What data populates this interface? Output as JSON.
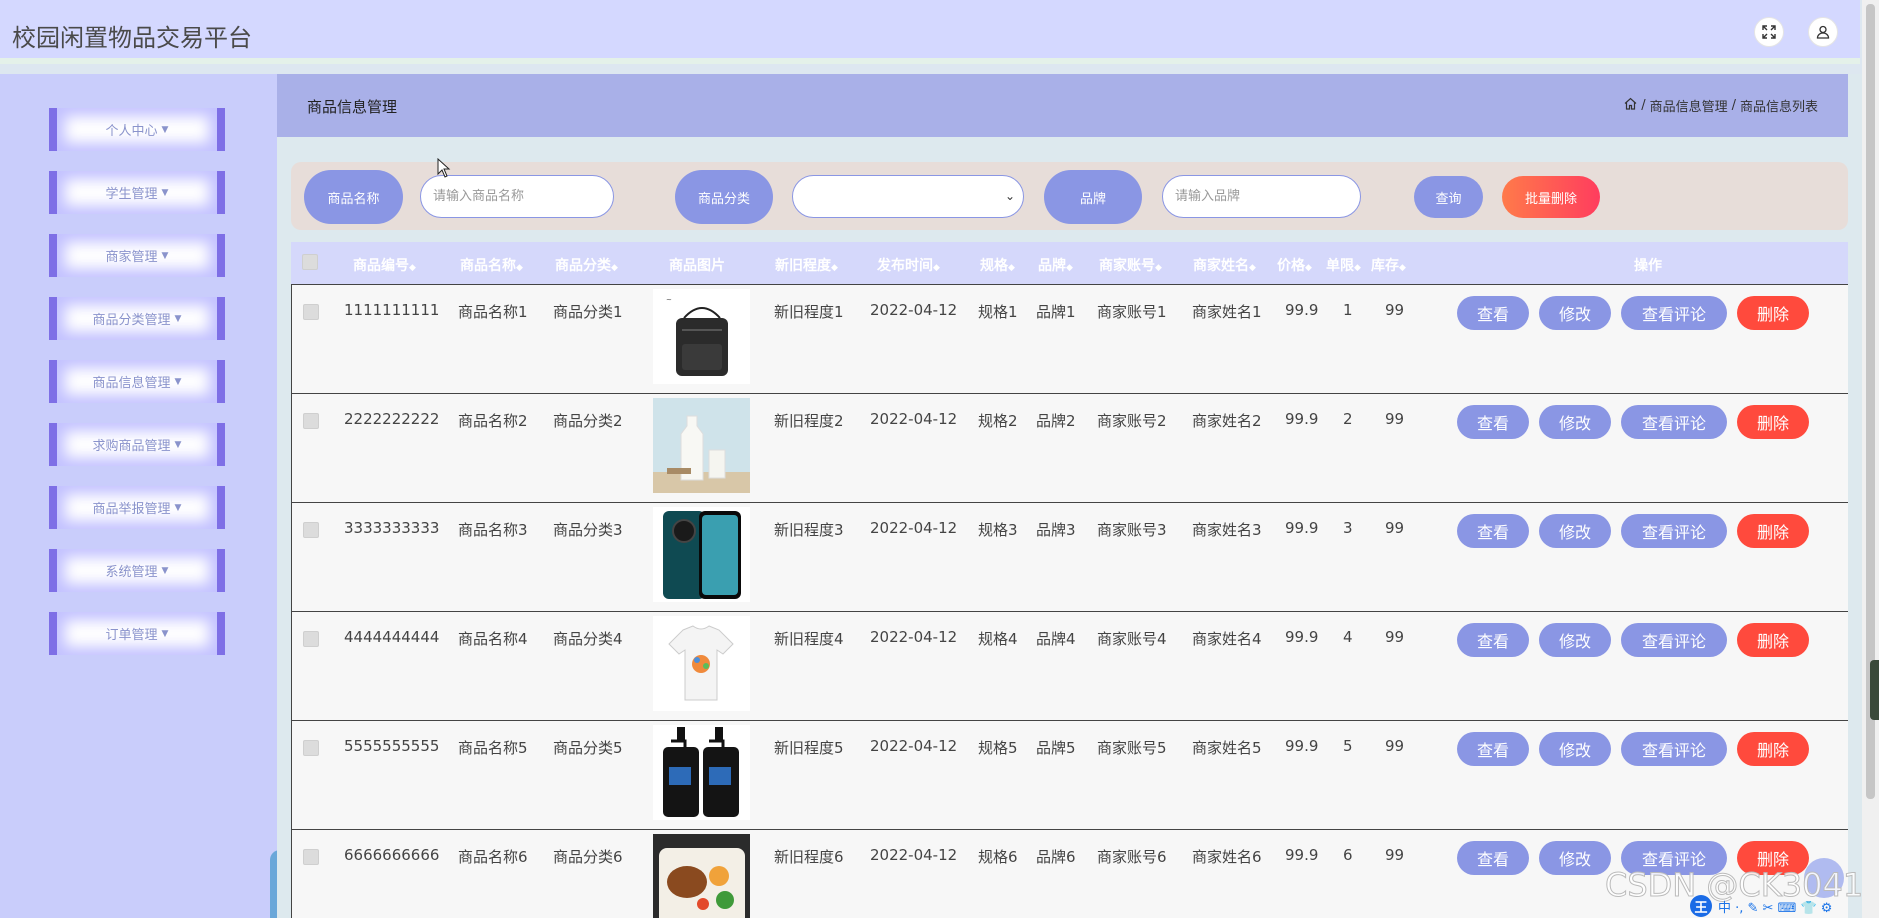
{
  "header": {
    "title": "校园闲置物品交易平台",
    "fullscreen_icon": "fullscreen-icon",
    "user_icon": "user-icon"
  },
  "sidebar": {
    "items": [
      {
        "label": "个人中心"
      },
      {
        "label": "学生管理"
      },
      {
        "label": "商家管理"
      },
      {
        "label": "商品分类管理"
      },
      {
        "label": "商品信息管理"
      },
      {
        "label": "求购商品管理"
      },
      {
        "label": "商品举报管理"
      },
      {
        "label": "系统管理"
      },
      {
        "label": "订单管理"
      }
    ]
  },
  "page": {
    "title": "商品信息管理",
    "breadcrumb": [
      "商品信息管理",
      "商品信息列表"
    ],
    "breadcrumb_sep": "/"
  },
  "search": {
    "name_label": "商品名称",
    "name_placeholder": "请输入商品名称",
    "category_label": "商品分类",
    "category_value": "",
    "brand_label": "品牌",
    "brand_placeholder": "请输入品牌",
    "query_button": "查询",
    "batch_delete_button": "批量删除"
  },
  "table": {
    "columns": [
      "商品编号",
      "商品名称",
      "商品分类",
      "商品图片",
      "新旧程度",
      "发布时间",
      "规格",
      "品牌",
      "商家账号",
      "商家姓名",
      "价格",
      "单限",
      "库存",
      "操作"
    ],
    "sort_glyph": "◆",
    "actions": {
      "view": "查看",
      "edit": "修改",
      "comments": "查看评论",
      "delete": "删除"
    },
    "rows": [
      {
        "id": "1111111111",
        "name": "商品名称1",
        "category": "商品分类1",
        "image": "shoulder-bag",
        "condition": "新旧程度1",
        "date": "2022-04-12",
        "spec": "规格1",
        "brand": "品牌1",
        "merchant_account": "商家账号1",
        "merchant_name": "商家姓名1",
        "price": "99.9",
        "limit": "1",
        "stock": "99"
      },
      {
        "id": "2222222222",
        "name": "商品名称2",
        "category": "商品分类2",
        "image": "milk-bottle",
        "condition": "新旧程度2",
        "date": "2022-04-12",
        "spec": "规格2",
        "brand": "品牌2",
        "merchant_account": "商家账号2",
        "merchant_name": "商家姓名2",
        "price": "99.9",
        "limit": "2",
        "stock": "99"
      },
      {
        "id": "3333333333",
        "name": "商品名称3",
        "category": "商品分类3",
        "image": "smartphone",
        "condition": "新旧程度3",
        "date": "2022-04-12",
        "spec": "规格3",
        "brand": "品牌3",
        "merchant_account": "商家账号3",
        "merchant_name": "商家姓名3",
        "price": "99.9",
        "limit": "3",
        "stock": "99"
      },
      {
        "id": "4444444444",
        "name": "商品名称4",
        "category": "商品分类4",
        "image": "t-shirt",
        "condition": "新旧程度4",
        "date": "2022-04-12",
        "spec": "规格4",
        "brand": "品牌4",
        "merchant_account": "商家账号4",
        "merchant_name": "商家姓名4",
        "price": "99.9",
        "limit": "4",
        "stock": "99"
      },
      {
        "id": "5555555555",
        "name": "商品名称5",
        "category": "商品分类5",
        "image": "lotion-bottles",
        "condition": "新旧程度5",
        "date": "2022-04-12",
        "spec": "规格5",
        "brand": "品牌5",
        "merchant_account": "商家账号5",
        "merchant_name": "商家姓名5",
        "price": "99.9",
        "limit": "5",
        "stock": "99"
      },
      {
        "id": "6666666666",
        "name": "商品名称6",
        "category": "商品分类6",
        "image": "food-box",
        "condition": "新旧程度6",
        "date": "2022-04-12",
        "spec": "规格6",
        "brand": "品牌6",
        "merchant_account": "商家账号6",
        "merchant_name": "商家姓名6",
        "price": "99.9",
        "limit": "6",
        "stock": "99"
      }
    ]
  },
  "overlay": {
    "watermark": "CSDN @CK3041",
    "ime_badge": "王",
    "ime_text": "中 ·, ✎ ✂ ⌨ 👕 ⚙"
  },
  "colors": {
    "accent": "#8a96e4",
    "danger": "#ff4a3d",
    "header_bg": "#d4d8ff",
    "sidebar_bg": "#c9cdfb",
    "sidebar_border": "#7e6fe6"
  }
}
